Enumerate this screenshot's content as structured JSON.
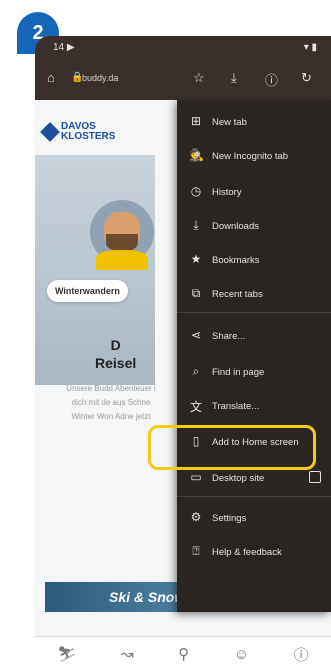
{
  "step_badge": "2",
  "status_bar": {
    "left": "14 ▶",
    "right": "▾ ▮"
  },
  "url_bar": {
    "url": "buddy.da"
  },
  "page": {
    "logo_line1": "DAVOS",
    "logo_line2": "KLOSTERS",
    "pill_label": "Winterwandern",
    "headline_line1": "D",
    "headline_line2": "Reisel",
    "paragraph": "Unsere Budd Abenteuer i dich mit de aus Schne Winter Won Adne jetzt",
    "banner": "Ski & Snowboard Buddy"
  },
  "menu": {
    "items": [
      {
        "label": "New tab",
        "icon": "plus-box-icon"
      },
      {
        "label": "New Incognito tab",
        "icon": "incognito-icon"
      },
      {
        "label": "History",
        "icon": "history-icon"
      },
      {
        "label": "Downloads",
        "icon": "download-icon"
      },
      {
        "label": "Bookmarks",
        "icon": "star-icon"
      },
      {
        "label": "Recent tabs",
        "icon": "recent-tabs-icon"
      },
      {
        "label": "Share...",
        "icon": "share-icon"
      },
      {
        "label": "Find in page",
        "icon": "find-icon"
      },
      {
        "label": "Translate...",
        "icon": "translate-icon"
      },
      {
        "label": "Add to Home screen",
        "icon": "add-home-icon"
      },
      {
        "label": "Desktop site",
        "icon": "desktop-icon"
      },
      {
        "label": "Settings",
        "icon": "gear-icon"
      },
      {
        "label": "Help & feedback",
        "icon": "help-icon"
      }
    ]
  },
  "colors": {
    "badge": "#1565b8",
    "highlight": "#f5cc14",
    "menu_bg": "#2b2522"
  }
}
